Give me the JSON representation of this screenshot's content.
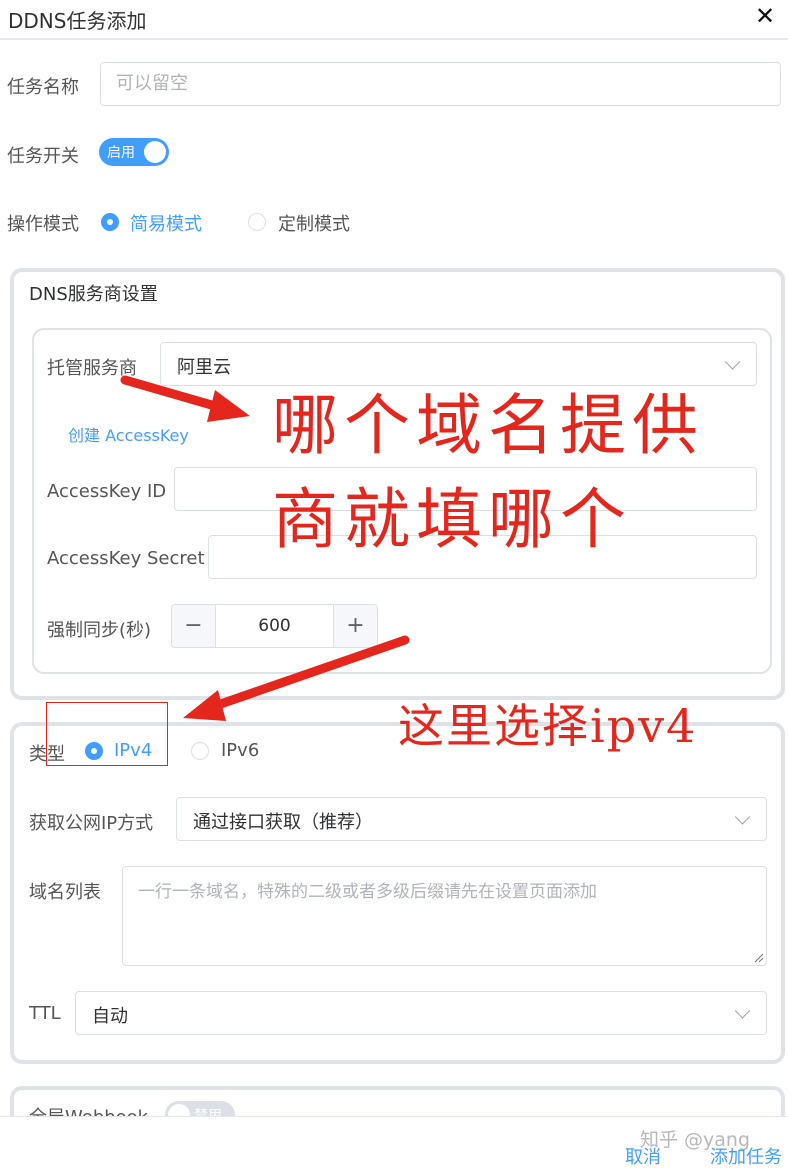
{
  "dialog": {
    "title": "DDNS任务添加",
    "close_symbol": "✕"
  },
  "task": {
    "name_label": "任务名称",
    "name_placeholder": "可以留空",
    "switch_label": "任务开关",
    "switch_text": "启用",
    "mode_label": "操作模式",
    "mode_simple": "简易模式",
    "mode_custom": "定制模式",
    "mode_selected": "简易模式"
  },
  "dns_section": {
    "title": "DNS服务商设置",
    "provider_label": "托管服务商",
    "provider_value": "阿里云",
    "create_link": "创建 AccessKey",
    "key_id_label": "AccessKey ID",
    "key_id_value": "",
    "key_secret_label": "AccessKey Secret",
    "key_secret_value": "",
    "sync_label": "强制同步(秒)",
    "sync_value": "600",
    "minus": "−",
    "plus": "+"
  },
  "domain_section": {
    "type_label": "类型",
    "ipv4": "IPv4",
    "ipv6": "IPv6",
    "type_selected": "IPv4",
    "ip_method_label": "获取公网IP方式",
    "ip_method_value": "通过接口获取（推荐）",
    "domain_list_label": "域名列表",
    "domain_list_placeholder": "一行一条域名，特殊的二级或者多级后缀请先在设置页面添加",
    "ttl_label": "TTL",
    "ttl_value": "自动"
  },
  "webhook_section": {
    "label": "全局Webhook",
    "switch_text": "禁用"
  },
  "annotations": {
    "provider_note_line1": "哪个域名提供",
    "provider_note_line2": "商就填哪个",
    "type_note": "这里选择ipv4"
  },
  "footer": {
    "cancel": "取消",
    "submit": "添加任务",
    "watermark": "知乎 @yang"
  },
  "colors": {
    "primary": "#409eff",
    "annotation": "#e4261c",
    "border": "#dcdfe6"
  }
}
